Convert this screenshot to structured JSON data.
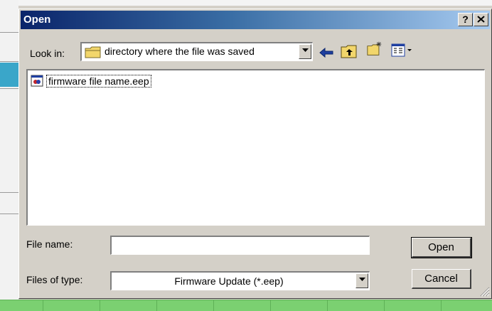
{
  "dialog": {
    "title": "Open",
    "help_label": "?",
    "close_label": "×"
  },
  "lookin": {
    "label": "Look in:",
    "value": "directory where the file was saved"
  },
  "files": [
    {
      "name": "firmware file name.eep"
    }
  ],
  "filename": {
    "label": "File name:",
    "value": ""
  },
  "filetype": {
    "label": "Files of type:",
    "value": "Firmware Update (*.eep)"
  },
  "buttons": {
    "open": "Open",
    "cancel": "Cancel"
  },
  "colors": {
    "titlebar_start": "#0a246a",
    "titlebar_end": "#a6caf0",
    "face": "#d4d0c8"
  },
  "icons": [
    "folder-icon",
    "back-arrow-icon",
    "up-one-level-icon",
    "new-folder-icon",
    "view-menu-icon",
    "file-icon",
    "size-grip-icon"
  ]
}
